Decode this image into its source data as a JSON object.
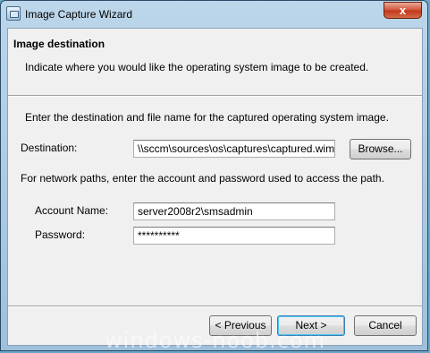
{
  "window": {
    "title": "Image Capture Wizard",
    "close_glyph": "x"
  },
  "header": {
    "title": "Image destination",
    "description": "Indicate where you would like the operating system image to be created."
  },
  "body": {
    "instructions": "Enter the destination and file name for the captured operating system image.",
    "destination_label": "Destination:",
    "destination_value": "\\\\sccm\\sources\\os\\captures\\captured.wim",
    "browse_label": "Browse...",
    "network_note": "For network paths, enter the account and password used to access the path.",
    "account_label": "Account Name:",
    "account_value": "server2008r2\\smsadmin",
    "password_label": "Password:",
    "password_value": "**********"
  },
  "footer": {
    "previous_label": "< Previous",
    "next_label": "Next >",
    "cancel_label": "Cancel"
  },
  "watermark": "windows-noob.com"
}
